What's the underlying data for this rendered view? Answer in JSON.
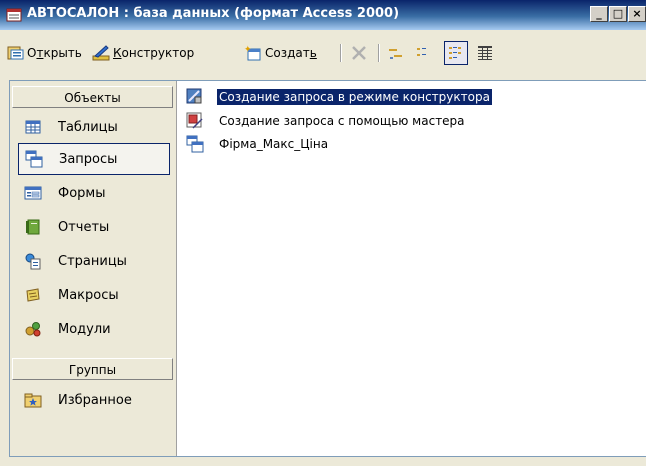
{
  "window": {
    "title": "АВТОСАЛОН : база данных (формат Access 2000)",
    "buttons": {
      "minimize": "_",
      "maximize": "□",
      "close": "×"
    }
  },
  "toolbar": {
    "open_first": "О",
    "open_key": "т",
    "open_rest": "крыть",
    "design_key": "К",
    "design_rest": "онструктор",
    "create_base": "Создат",
    "create_key": "ь"
  },
  "sidebar": {
    "objects_header": "Объекты",
    "items": [
      {
        "label": "Таблицы",
        "icon": "table-icon"
      },
      {
        "label": "Запросы",
        "icon": "query-icon",
        "active": true
      },
      {
        "label": "Формы",
        "icon": "form-icon"
      },
      {
        "label": "Отчеты",
        "icon": "report-icon"
      },
      {
        "label": "Страницы",
        "icon": "page-icon"
      },
      {
        "label": "Макросы",
        "icon": "macro-icon"
      },
      {
        "label": "Модули",
        "icon": "module-icon"
      }
    ],
    "groups_header": "Группы",
    "favorites": {
      "label": "Избранное",
      "icon": "favorites-icon"
    }
  },
  "list": {
    "items": [
      {
        "label": "Создание запроса в режиме конструктора",
        "selected": true,
        "icon": "design-wizard-icon"
      },
      {
        "label": "Создание запроса с помощью мастера",
        "icon": "wizard-icon"
      },
      {
        "label": "Фірма_Макс_Ціна",
        "icon": "query-icon"
      }
    ]
  },
  "colors": {
    "title_start": "#0a246a",
    "title_end": "#a6caf0",
    "selection": "#0a246a",
    "face": "#ece9d8"
  }
}
